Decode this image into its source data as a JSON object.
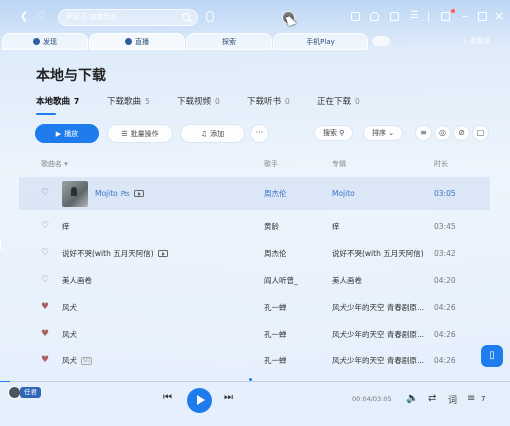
{
  "titlebar": {
    "search_placeholder": "萨丽莎 如愿印水",
    "icons": [
      "back-icon",
      "forward-icon",
      "search-icon",
      "mic-icon",
      "message-icon",
      "skin-icon",
      "mail-icon",
      "menu-icon",
      "minimode-icon",
      "minimize-icon",
      "maximize-icon",
      "close-icon"
    ]
  },
  "tabs": [
    {
      "label": "发现"
    },
    {
      "label": "直播"
    },
    {
      "label": "探索"
    },
    {
      "label": "手机Play"
    }
  ],
  "tab_add": "+",
  "lyric_label": "桌面词",
  "page": {
    "title": "本地与下载",
    "subtabs": [
      {
        "label": "本地歌曲",
        "count": "7"
      },
      {
        "label": "下载歌曲",
        "count": "5"
      },
      {
        "label": "下载视频",
        "count": "0"
      },
      {
        "label": "下载听书",
        "count": "0"
      },
      {
        "label": "正在下载",
        "count": "0"
      }
    ],
    "toolbar": {
      "play_label": "播放",
      "batch_label": "批量操作",
      "add_label": "添加",
      "more_label": "···",
      "search_label": "搜索",
      "sort_label": "排序"
    }
  },
  "table": {
    "headers": {
      "title": "歌曲名",
      "artist": "歌手",
      "album": "专辑",
      "duration": "时长"
    },
    "rows": [
      {
        "title": "Mojito",
        "artist": "周杰伦",
        "album": "Mojito",
        "duration": "03:05",
        "liked": false,
        "playing": true
      },
      {
        "title": "痒",
        "artist": "黄龄",
        "album": "痒",
        "duration": "03:45",
        "liked": false
      },
      {
        "title": "说好不哭(with 五月天阿信)",
        "artist": "周杰伦",
        "album": "说好不哭(with 五月天阿信)",
        "duration": "03:42",
        "liked": false
      },
      {
        "title": "美人画卷",
        "artist": "阎人听曾_",
        "album": "美人画卷",
        "duration": "04:20",
        "liked": false
      },
      {
        "title": "风犬",
        "artist": "孔一蝉",
        "album": "风犬少年的天空 青春剧原...",
        "duration": "04:26",
        "liked": true
      },
      {
        "title": "风犬",
        "artist": "孔一蝉",
        "album": "风犬少年的天空 青春剧原...",
        "duration": "04:26",
        "liked": true
      },
      {
        "title": "风犬",
        "artist": "孔一蝉",
        "album": "风犬少年的天空 青春剧原...",
        "duration": "04:26",
        "liked": true
      }
    ]
  },
  "player": {
    "user_name": "任君",
    "time": "00:04/03:05",
    "progress_fraction": 0.02,
    "queue_count": "7"
  },
  "colors": {
    "accent": "#1f7cec",
    "liked": "#a86060",
    "playing_text": "#3a73c9"
  }
}
